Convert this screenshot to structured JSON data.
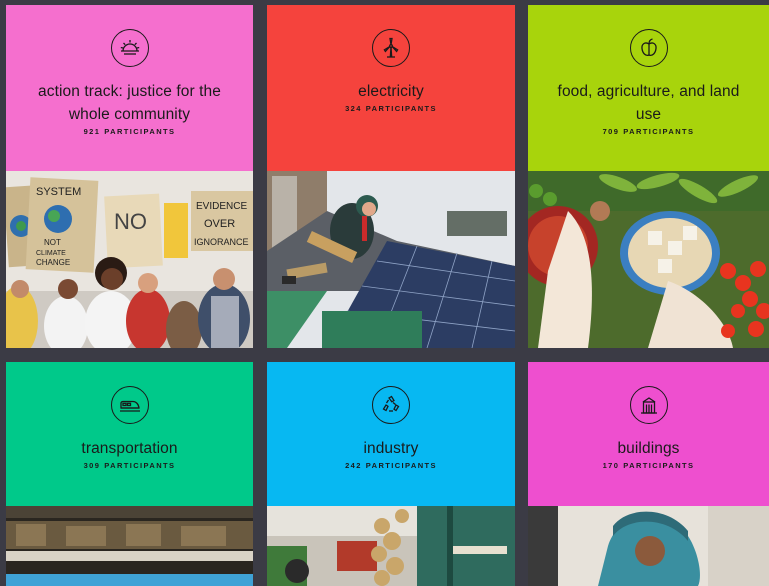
{
  "colors": {
    "page_bg": "#3b3b45",
    "pink": "#f56fce",
    "red": "#f5433d",
    "lime": "#a8d40c",
    "green": "#00c98a",
    "blue": "#07b8f2",
    "magenta": "#ee4fcf"
  },
  "cards": [
    {
      "title_line1": "action track: justice for the",
      "title_line2": "whole community",
      "count": "921",
      "count_label": "participants",
      "icon": "sunrise-icon",
      "color": "#f56fce"
    },
    {
      "title_line1": "electricity",
      "title_line2": "",
      "count": "324",
      "count_label": "participants",
      "icon": "wind-turbine-icon",
      "color": "#f5433d"
    },
    {
      "title_line1": "food, agriculture, and land",
      "title_line2": "use",
      "count": "709",
      "count_label": "participants",
      "icon": "apple-icon",
      "color": "#a8d40c"
    },
    {
      "title_line1": "transportation",
      "title_line2": "",
      "count": "309",
      "count_label": "participants",
      "icon": "train-icon",
      "color": "#00c98a"
    },
    {
      "title_line1": "industry",
      "title_line2": "",
      "count": "242",
      "count_label": "participants",
      "icon": "recycle-icon",
      "color": "#07b8f2"
    },
    {
      "title_line1": "buildings",
      "title_line2": "",
      "count": "170",
      "count_label": "participants",
      "icon": "building-icon",
      "color": "#ee4fcf"
    }
  ],
  "photo_signs": {
    "sign1": "SYSTEM",
    "sign2": "CHANGE",
    "sign3": "NOT",
    "sign4": "CLIMATE",
    "sign5": "NO",
    "sign6": "EVIDENCE",
    "sign7": "OVER",
    "sign8": "IGNORANCE"
  }
}
